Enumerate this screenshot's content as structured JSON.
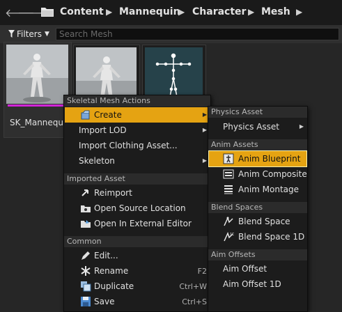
{
  "path": {
    "crumbs": [
      "Content",
      "Mannequin",
      "Character",
      "Mesh"
    ],
    "icons": [
      "back-arrow-icon",
      "forward-arrow-icon",
      "folder-icon",
      "chevron-right-icon"
    ]
  },
  "filter": {
    "filters_label": "Filters",
    "search_placeholder": "Search Mesh"
  },
  "assets": [
    {
      "name": "SK_Mannequin",
      "type_color": "#d225d8"
    }
  ],
  "context_menu": {
    "sections": [
      {
        "title": "Skeletal Mesh Actions",
        "items": [
          {
            "label": "Create",
            "icon": "create-icon",
            "has_submenu": true
          },
          {
            "label": "Import LOD",
            "has_submenu": true
          },
          {
            "label": "Import Clothing Asset..."
          },
          {
            "label": "Skeleton",
            "has_submenu": true
          }
        ]
      },
      {
        "title": "Imported Asset",
        "items": [
          {
            "label": "Reimport",
            "icon": "reimport-icon"
          },
          {
            "label": "Open Source Location",
            "icon": "open-source-location-icon"
          },
          {
            "label": "Open In External Editor",
            "icon": "external-editor-icon"
          }
        ]
      },
      {
        "title": "Common",
        "items": [
          {
            "label": "Edit...",
            "icon": "edit-icon"
          },
          {
            "label": "Rename",
            "icon": "rename-icon",
            "shortcut": "F2"
          },
          {
            "label": "Duplicate",
            "icon": "duplicate-icon",
            "shortcut": "Ctrl+W"
          },
          {
            "label": "Save",
            "icon": "save-icon",
            "shortcut": "Ctrl+S"
          }
        ]
      }
    ]
  },
  "submenu": {
    "sections": [
      {
        "title": "Physics Asset",
        "items": [
          {
            "label": "Physics Asset",
            "has_submenu": true
          }
        ]
      },
      {
        "title": "Anim Assets",
        "items": [
          {
            "label": "Anim Blueprint",
            "icon": "anim-blueprint-icon"
          },
          {
            "label": "Anim Composite",
            "icon": "anim-composite-icon"
          },
          {
            "label": "Anim Montage",
            "icon": "anim-montage-icon"
          }
        ]
      },
      {
        "title": "Blend Spaces",
        "items": [
          {
            "label": "Blend Space",
            "icon": "blend-space-icon"
          },
          {
            "label": "Blend Space 1D",
            "icon": "blend-space-1d-icon"
          }
        ]
      },
      {
        "title": "Aim Offsets",
        "items": [
          {
            "label": "Aim Offset"
          },
          {
            "label": "Aim Offset 1D"
          }
        ]
      }
    ]
  },
  "colors": {
    "highlight": "#e5a312",
    "background": "#262626",
    "menu": "#1c1c1c",
    "section": "#2b2b2b"
  }
}
